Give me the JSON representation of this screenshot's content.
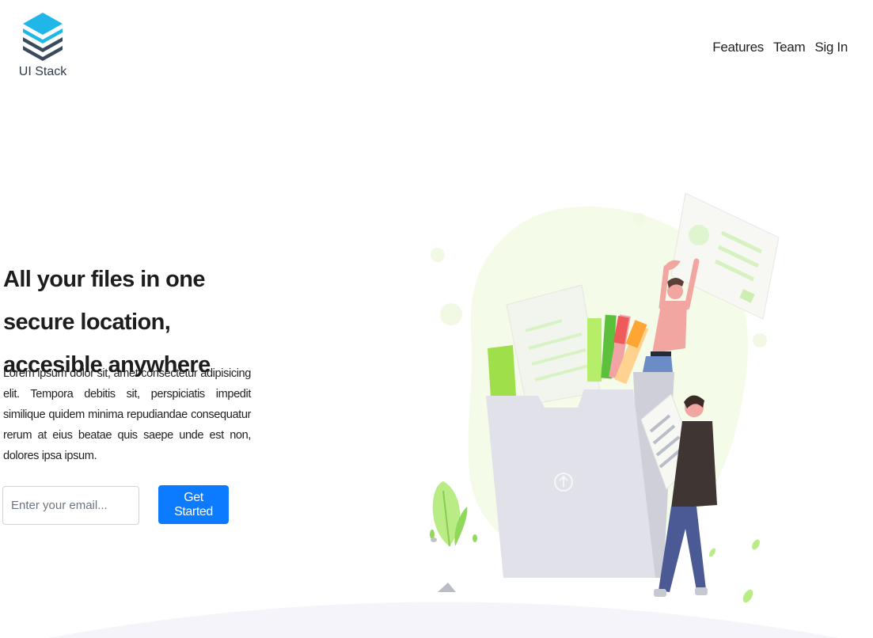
{
  "brand": {
    "logo_text": "UI Stack",
    "logo_colors": [
      "#1fb6e8",
      "#3a4a5c"
    ]
  },
  "nav": {
    "items": [
      {
        "label": "Features"
      },
      {
        "label": "Team"
      },
      {
        "label": "Sig In"
      }
    ]
  },
  "hero": {
    "title": "All your files in one secure location, accesible anywhere",
    "description": "Lorem ipsum dolor sit, amet consectetur adipisicing elit. Tempora debitis sit, perspiciatis impedit similique quidem minima repudiandae consequatur rerum at eius beatae quis saepe unde est non, dolores ipsa ipsum.",
    "email_placeholder": "Enter your email...",
    "cta_label": "Get Started"
  },
  "colors": {
    "accent": "#0d7bff",
    "blob": "#f4fbe8",
    "ground": "#f4f4fa"
  }
}
